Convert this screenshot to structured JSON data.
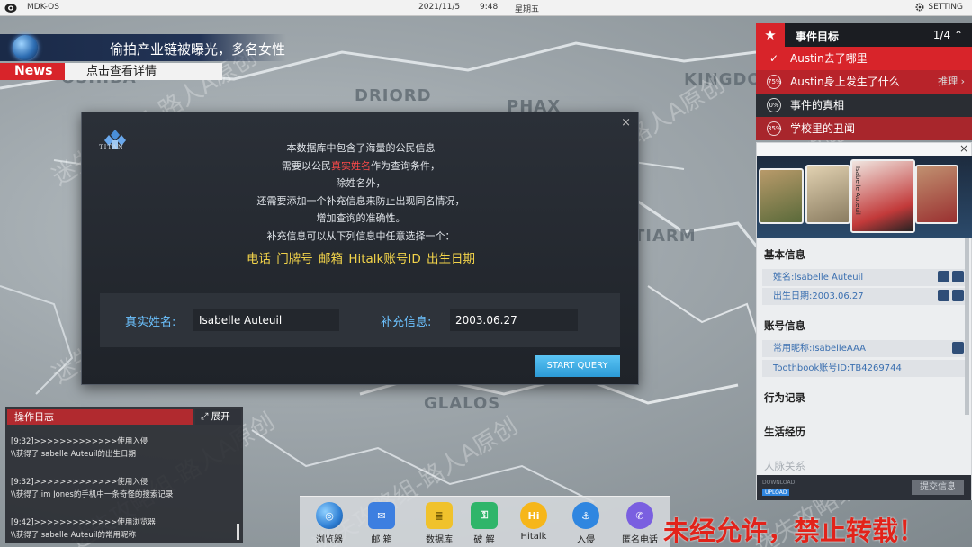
{
  "topbar": {
    "os_name": "MDK-OS",
    "date": "2021/11/5",
    "time": "9:48",
    "weekday": "星期五",
    "setting_label": "SETTING"
  },
  "news": {
    "headline": "偷拍产业链被曝光，多名女性",
    "label": "News",
    "link": "点击查看详情"
  },
  "map": {
    "districts": [
      "DRIORD",
      "PHAX",
      "TIARM",
      "GLALOS",
      "KINGDO",
      "OSHIBA"
    ]
  },
  "watermark": "迷失攻略组-路人A原创",
  "dialog": {
    "logo_text": "TITAN",
    "close": "×",
    "desc": {
      "line1": "本数据库中包含了海量的公民信息",
      "line2_pre": "需要以公民",
      "line2_highlight": "真实姓名",
      "line2_post": "作为查询条件，",
      "line3": "除姓名外，",
      "line4": "还需要添加一个补充信息来防止出现同名情况，",
      "line5": "增加查询的准确性。",
      "line6": "补充信息可以从下列信息中任意选择一个："
    },
    "options": "电话  门牌号  邮箱  Hitalk账号ID  出生日期",
    "name_label": "真实姓名:",
    "name_value": "Isabelle Auteuil",
    "extra_label": "补充信息:",
    "extra_value": "2003.06.27",
    "query_button": "START QUERY"
  },
  "oplog": {
    "title": "操作日志",
    "expand": "展开",
    "entries": [
      {
        "time": "[9:32]>>>>>>>>>>>>>使用入侵",
        "text": "\\\\获得了Isabelle Auteuil的出生日期"
      },
      {
        "time": "[9:32]>>>>>>>>>>>>>使用入侵",
        "text": "\\\\获得了Jim Jones的手机中一条奇怪的搜索记录"
      },
      {
        "time": "[9:42]>>>>>>>>>>>>>使用浏览器",
        "text": "\\\\获得了Isabelle Auteuil的常用昵称"
      }
    ]
  },
  "dock": {
    "items": [
      {
        "label": "浏览器",
        "icon": "browser-icon",
        "color": "#2f7fd4"
      },
      {
        "label": "邮 箱",
        "icon": "mail-icon",
        "color": "#3d7fe0"
      },
      {
        "label": "数据库",
        "icon": "database-icon",
        "color": "#f0c22c"
      },
      {
        "label": "破 解",
        "icon": "crack-icon",
        "color": "#2fb56a"
      },
      {
        "label": "Hitalk",
        "icon": "hitalk-icon",
        "color": "#f6b61a"
      },
      {
        "label": "入侵",
        "icon": "hook-icon",
        "color": "#2f86e0"
      },
      {
        "label": "匿名电话",
        "icon": "phone-icon",
        "color": "#7a5fe0"
      }
    ]
  },
  "bottom_warning": "未经允许，禁止转载！",
  "goals": {
    "title": "事件目标",
    "count": "1/4",
    "items": [
      {
        "badge": "✓",
        "text": "Austin去了哪里",
        "extra": "",
        "bg": "#d8242a"
      },
      {
        "badge": "75%",
        "text": "Austin身上发生了什么",
        "extra": "推理",
        "bg": "#b8232a"
      },
      {
        "badge": "0%",
        "text": "事件的真相",
        "extra": "",
        "bg": "#2a2d33"
      },
      {
        "badge": "35%",
        "text": "学校里的丑闻",
        "extra": "",
        "bg": "#a8262c"
      }
    ]
  },
  "profile": {
    "close": "×",
    "featured_name": "Isabelle Auteuil",
    "basic_title": "基本信息",
    "basic": [
      "姓名:Isabelle Auteuil",
      "出生日期:2003.06.27"
    ],
    "account_title": "账号信息",
    "accounts": [
      "常用昵称:IsabelleAAA",
      "Toothbook账号ID:TB4269744"
    ],
    "behavior_title": "行为记录",
    "life_title": "生活经历",
    "relations_title": "人脉关系",
    "footer": {
      "download": "DOWNLOAD",
      "upload": "UPLOAD",
      "submit": "提交信息"
    }
  }
}
